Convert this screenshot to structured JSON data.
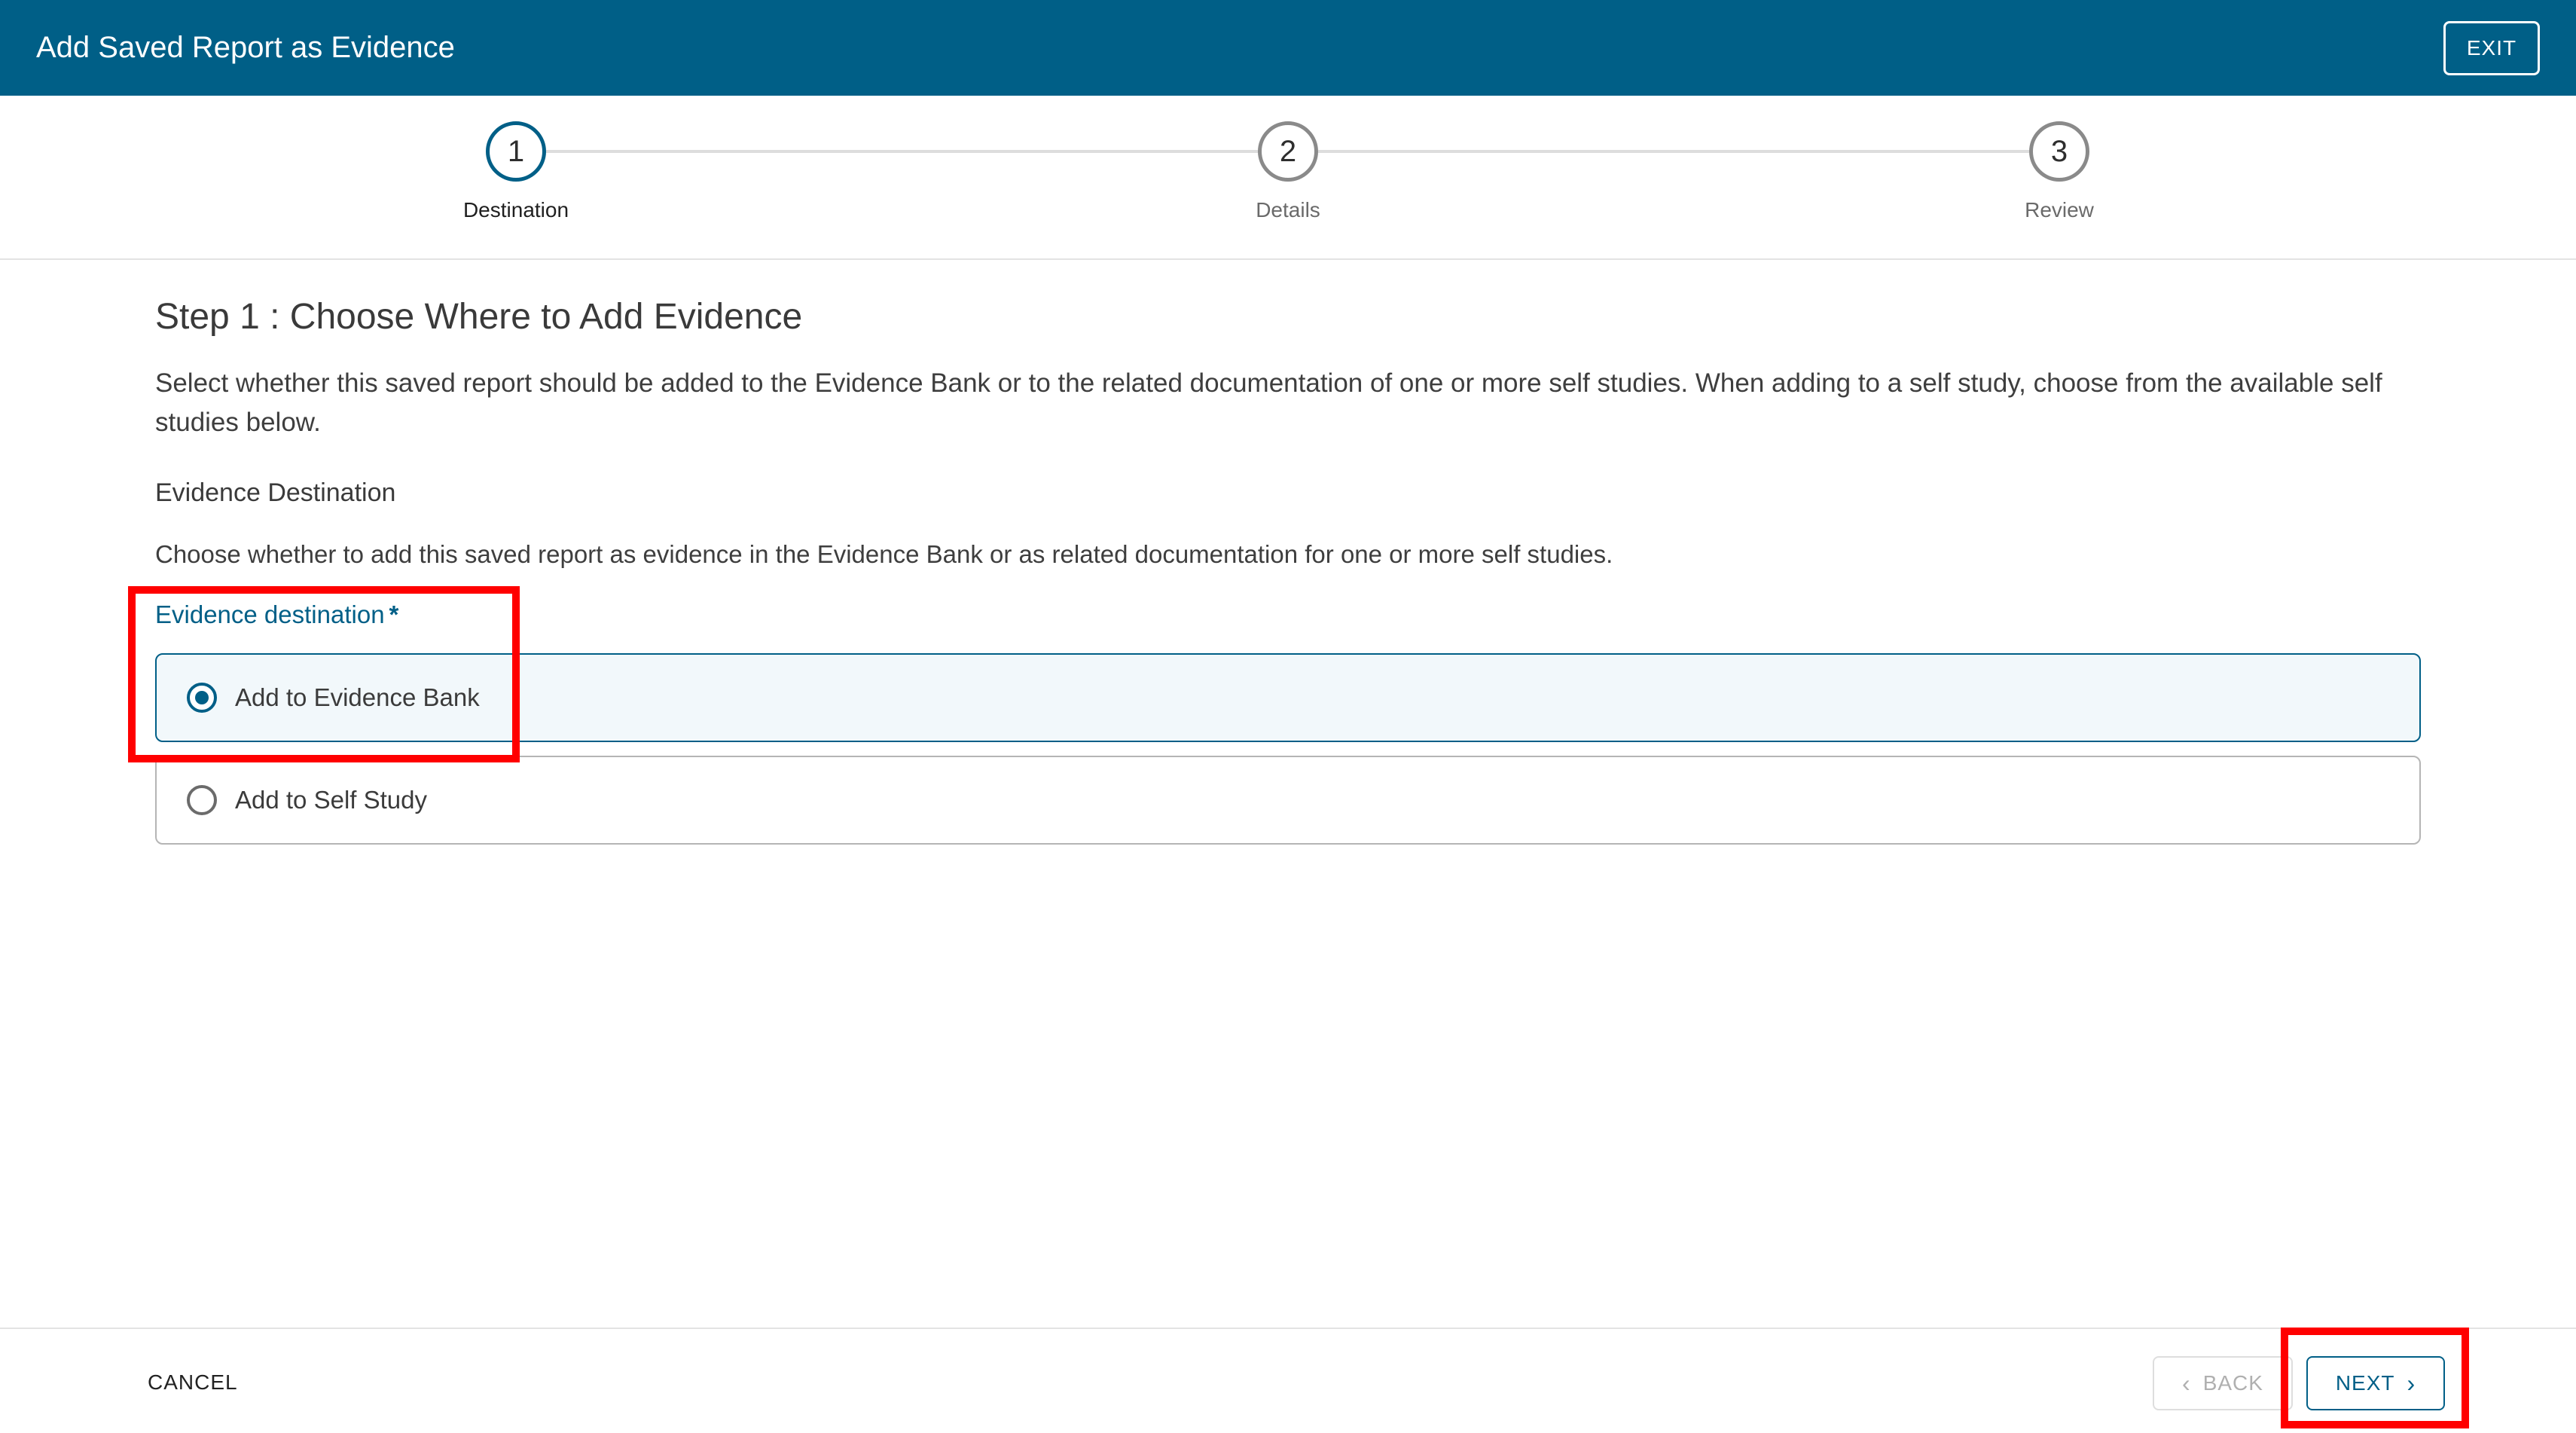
{
  "header": {
    "title": "Add Saved Report as Evidence",
    "exit_label": "EXIT",
    "background_color": "#005f87"
  },
  "stepper": {
    "steps": [
      {
        "number": "1",
        "label": "Destination",
        "state": "active"
      },
      {
        "number": "2",
        "label": "Details",
        "state": "inactive"
      },
      {
        "number": "3",
        "label": "Review",
        "state": "inactive"
      }
    ]
  },
  "main": {
    "heading": "Step 1 : Choose Where to Add Evidence",
    "intro": "Select whether this saved report should be added to the Evidence Bank or to the related documentation of one or more self studies. When adding to a self study, choose from the available self studies below.",
    "section_title": "Evidence Destination",
    "section_description": "Choose whether to add this saved report as evidence in the Evidence Bank or as related documentation for one or more self studies.",
    "field_label": "Evidence destination",
    "required_marker": "*",
    "options": [
      {
        "label": "Add to Evidence Bank",
        "selected": true
      },
      {
        "label": "Add to Self Study",
        "selected": false
      }
    ]
  },
  "footer": {
    "cancel_label": "CANCEL",
    "back_label": "BACK",
    "back_icon": "chevron-left-icon",
    "next_label": "NEXT",
    "next_icon": "chevron-right-icon",
    "back_disabled": true
  },
  "annotations": {
    "highlight_color": "#ff0000"
  }
}
